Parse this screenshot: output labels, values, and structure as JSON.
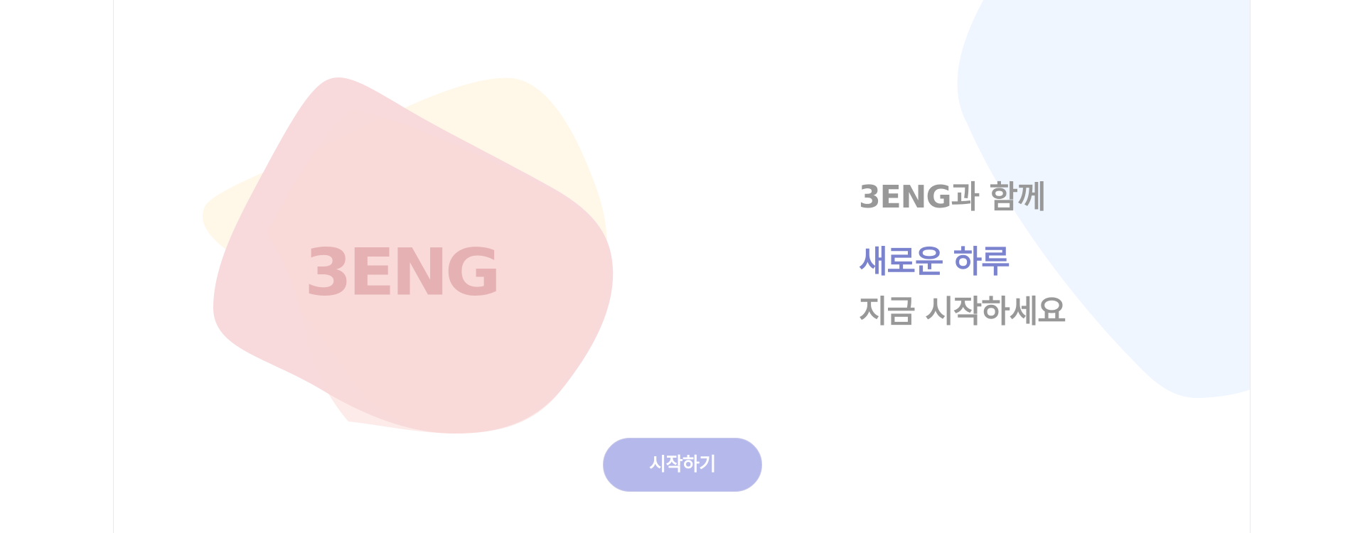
{
  "logo": {
    "text": "3ENG"
  },
  "hero": {
    "line1": "3ENG과 함께",
    "line2": "새로운 하루",
    "line3": "지금 시작하세요"
  },
  "cta": {
    "start_label": "시작하기"
  },
  "colors": {
    "accent_text": "#7b83cf",
    "muted_text": "#989898",
    "button_bg": "#b5b8eb",
    "logo_text": "#e5b1b2",
    "blob_yellow": "#fff8e8",
    "blob_pink": "#f8d7da",
    "blob_peach": "#f9dad7",
    "blob_blue": "#eff6ff"
  }
}
